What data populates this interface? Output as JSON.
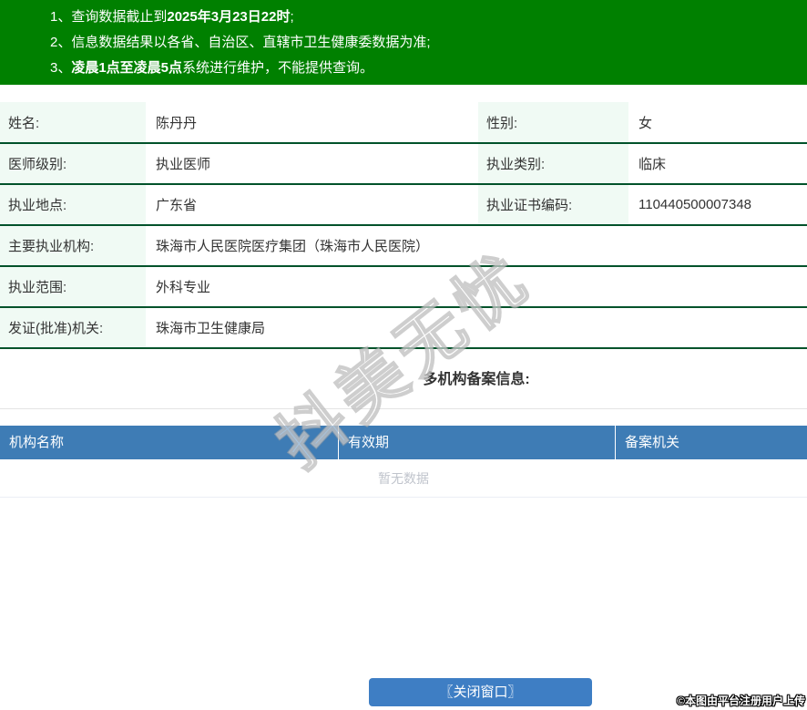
{
  "notice": {
    "items": [
      {
        "num": "1、",
        "pre": "查询数据截止到",
        "bold": "2025年3月23日22时",
        "post": ";"
      },
      {
        "num": "2、",
        "pre": "信息数据结果以各省、自治区、直辖市卫生健康委数据为准;",
        "bold": "",
        "post": ""
      },
      {
        "num": "3、",
        "pre": "",
        "bold": "凌晨1点至凌晨5点",
        "post": "系统进行维护，不能提供查询。"
      }
    ]
  },
  "info": {
    "rows2col": [
      {
        "label1": "姓名:",
        "value1": "陈丹丹",
        "label2": "性别:",
        "value2": "女"
      },
      {
        "label1": "医师级别:",
        "value1": "执业医师",
        "label2": "执业类别:",
        "value2": "临床"
      },
      {
        "label1": "执业地点:",
        "value1": "广东省",
        "label2": "执业证书编码:",
        "value2": "110440500007348"
      }
    ],
    "rows1col": [
      {
        "label": "主要执业机构:",
        "value": "珠海市人民医院医疗集团（珠海市人民医院）"
      },
      {
        "label": "执业范围:",
        "value": "外科专业"
      },
      {
        "label": "发证(批准)机关:",
        "value": "珠海市卫生健康局"
      }
    ]
  },
  "section": {
    "title": "多机构备案信息:"
  },
  "filing_table": {
    "headers": [
      "机构名称",
      "有效期",
      "备案机关"
    ],
    "empty_text": "暂无数据",
    "rows": []
  },
  "close_button": {
    "label": "〖关闭窗口〗"
  },
  "watermark": {
    "diagonal": "抖美无忧",
    "copyright": "©本图由平台注册用户上传"
  },
  "colors": {
    "green_header": "#008000",
    "row_border": "#00522a",
    "label_bg": "#f0faf4",
    "table_header_bg": "#3e7cb5",
    "button_bg": "#3e7ec4",
    "empty_text": "#c0c4cc"
  }
}
